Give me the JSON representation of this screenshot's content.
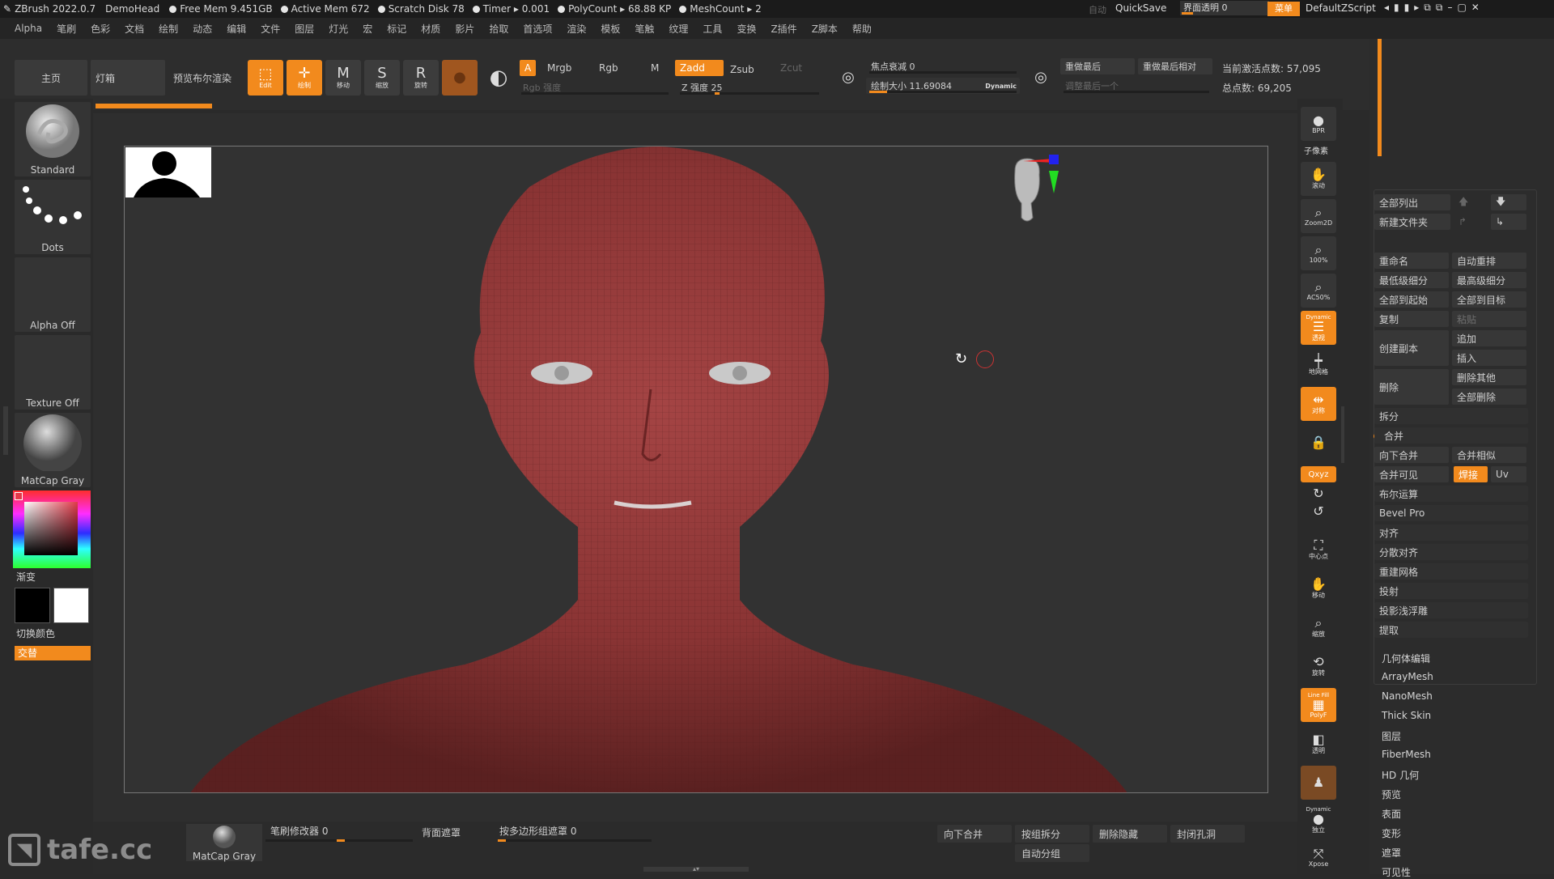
{
  "titlebar": {
    "app": "ZBrush 2022.0.7",
    "doc": "DemoHead",
    "free_mem": "Free Mem 9.451GB",
    "active_mem": "Active Mem 672",
    "scratch": "Scratch Disk 78",
    "timer": "Timer ▸ 0.001",
    "polycount": "PolyCount ▸ 68.88 KP",
    "meshcount": "MeshCount ▸ 2",
    "auto": "自动",
    "quicksave": "QuickSave",
    "transparency": "界面透明 0",
    "menu_btn": "菜单",
    "script": "DefaultZScript"
  },
  "menus": [
    "Alpha",
    "笔刷",
    "色彩",
    "文档",
    "绘制",
    "动态",
    "编辑",
    "文件",
    "图层",
    "灯光",
    "宏",
    "标记",
    "材质",
    "影片",
    "拾取",
    "首选项",
    "渲染",
    "模板",
    "笔触",
    "纹理",
    "工具",
    "变换",
    "Z插件",
    "Z脚本",
    "帮助"
  ],
  "shelf": {
    "tab_home": "主页",
    "tab_lightbox": "灯箱",
    "tab_preview": "预览布尔渲染",
    "btn_edit": "Edit",
    "btn_draw": "绘制",
    "btn_move": "移动",
    "btn_scale": "缩放",
    "btn_rotate": "旋转",
    "a_label": "A",
    "mrgb": "Mrgb",
    "rgb": "Rgb",
    "m": "M",
    "zadd": "Zadd",
    "zsub": "Zsub",
    "zcut": "Zcut",
    "rgb_intensity": "Rgb 强度",
    "z_intensity": "Z 强度 25",
    "focal": "焦点衰减 0",
    "draw_size": "绘制大小 11.69084",
    "dynamic": "Dynamic",
    "redo_last": "重做最后",
    "redo_last_rel": "重做最后相对",
    "adjust_last": "调整最后一个",
    "active_points": "当前激活点数: 57,095",
    "total_points": "总点数: 69,205",
    "z_intensity_value": 25,
    "focal_value": 0
  },
  "left": {
    "brush": "Standard",
    "stroke": "Dots",
    "alpha": "Alpha Off",
    "texture": "Texture Off",
    "material": "MatCap Gray",
    "gradient": "渐变",
    "switch_color": "切换颜色",
    "alternate": "交替"
  },
  "right": {
    "bpr": "BPR",
    "subpixel": "子像素",
    "scroll": "滚动",
    "zoom2d": "Zoom2D",
    "p100": "100%",
    "ac50": "AC50%",
    "persp": "透视",
    "persp_top": "Dynamic",
    "floor": "地网格",
    "symmetry": "对称",
    "lock": "",
    "xyz": "Qxyz",
    "frame": "中心点",
    "move": "移动",
    "scale": "缩放",
    "rotate": "旋转",
    "linefill": "Line Fill",
    "polyf": "PolyF",
    "transp": "透明",
    "dynamic": "Dynamic",
    "solo": "独立",
    "xpose": "Xpose"
  },
  "subtool": {
    "list_all": "全部列出",
    "new_folder": "新建文件夹",
    "rename": "重命名",
    "auto_reorder": "自动重排",
    "lowest_sub": "最低级细分",
    "highest_sub": "最高级细分",
    "all_to_start": "全部到起始",
    "all_to_target": "全部到目标",
    "copy": "复制",
    "paste": "粘贴",
    "duplicate": "创建副本",
    "append": "追加",
    "insert": "插入",
    "delete": "删除",
    "delete_other": "删除其他",
    "delete_all": "全部删除",
    "split": "拆分",
    "merge": "合并",
    "merge_down": "向下合并",
    "merge_similar": "合并相似",
    "merge_visible": "合并可见",
    "weld": "焊接",
    "uv": "Uv",
    "boolean": "布尔运算",
    "bevel_pro": "Bevel Pro",
    "align": "对齐",
    "distribute": "分散对齐",
    "remesh": "重建网格",
    "project": "投射",
    "project_bas": "投影浅浮雕",
    "extract": "提取",
    "geometry": "几何体编辑",
    "arraymesh": "ArrayMesh",
    "nanomesh": "NanoMesh",
    "thickskin": "Thick Skin",
    "layers": "图层",
    "fibermesh": "FiberMesh",
    "hd_geo": "HD 几何",
    "preview": "预览",
    "surface": "表面",
    "deform": "变形",
    "masking": "遮罩",
    "visibility": "可见性"
  },
  "bottom": {
    "material": "MatCap Gray",
    "brush_modifier": "笔刷修改器 0",
    "backface": "背面遮罩",
    "polygroup_mask": "按多边形组遮罩 0",
    "merge_down": "向下合并",
    "group_split": "按组拆分",
    "del_hidden": "删除隐藏",
    "close_holes": "封闭孔洞",
    "auto_group": "自动分组"
  },
  "watermark": "tafe.cc",
  "colors": {
    "accent": "#f28a1d",
    "skin": "#8e3434"
  }
}
